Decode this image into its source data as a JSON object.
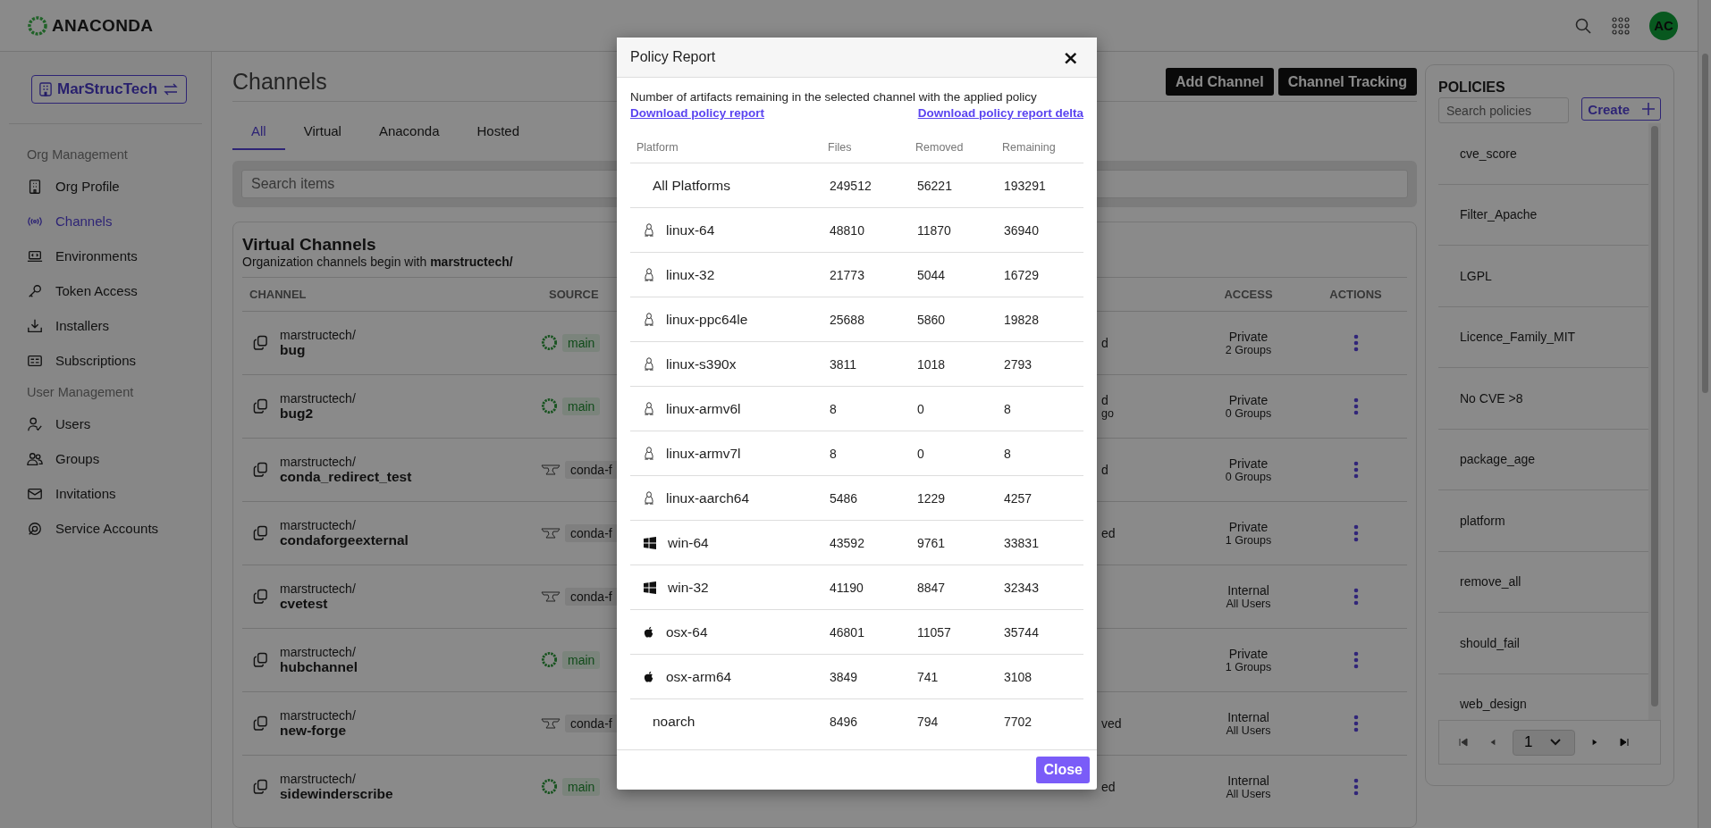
{
  "header": {
    "logo": "ANACONDA",
    "avatar": "AC"
  },
  "sidebar": {
    "org": "MarStrucTech",
    "sections": [
      {
        "title": "Org Management",
        "items": [
          {
            "label": "Org Profile",
            "selected": false
          },
          {
            "label": "Channels",
            "selected": true
          },
          {
            "label": "Environments",
            "selected": false
          },
          {
            "label": "Token Access",
            "selected": false
          },
          {
            "label": "Installers",
            "selected": false
          },
          {
            "label": "Subscriptions",
            "selected": false
          }
        ]
      },
      {
        "title": "User Management",
        "items": [
          {
            "label": "Users",
            "selected": false
          },
          {
            "label": "Groups",
            "selected": false
          },
          {
            "label": "Invitations",
            "selected": false
          },
          {
            "label": "Service Accounts",
            "selected": false
          }
        ]
      }
    ]
  },
  "page": {
    "title": "Channels",
    "buttons": [
      "Add Channel",
      "Channel Tracking"
    ],
    "tabs": [
      {
        "label": "All",
        "selected": true
      },
      {
        "label": "Virtual",
        "selected": false
      },
      {
        "label": "Anaconda",
        "selected": false
      },
      {
        "label": "Hosted",
        "selected": false
      }
    ],
    "search": {
      "placeholder": "Search items"
    }
  },
  "card": {
    "title": "Virtual Channels",
    "subtitle": "Organization channels begin with **marstructech/**",
    "columns": [
      "CHANNEL",
      "SOURCE",
      "ACCESS",
      "ACTIONS"
    ],
    "rows": [
      {
        "prefix": "marstructech/",
        "name": "bug",
        "source": {
          "kind": "anaconda",
          "label": "main"
        },
        "status": [
          "d"
        ],
        "access": "Private",
        "access_detail": "2 Groups"
      },
      {
        "prefix": "marstructech/",
        "name": "bug2",
        "source": {
          "kind": "anaconda",
          "label": "main"
        },
        "status": [
          "d",
          "go"
        ],
        "access": "Private",
        "access_detail": "0 Groups"
      },
      {
        "prefix": "marstructech/",
        "name": "conda_redirect_test",
        "source": {
          "kind": "forge",
          "label": "conda-f"
        },
        "status": [
          "d"
        ],
        "access": "Private",
        "access_detail": "0 Groups"
      },
      {
        "prefix": "marstructech/",
        "name": "condaforgeexternal",
        "source": {
          "kind": "forge",
          "label": "conda-f"
        },
        "status": [
          "ed"
        ],
        "access": "Private",
        "access_detail": "1 Groups"
      },
      {
        "prefix": "marstructech/",
        "name": "cvetest",
        "source": {
          "kind": "forge",
          "label": "conda-f"
        },
        "access": "Internal",
        "access_detail": "All Users"
      },
      {
        "prefix": "marstructech/",
        "name": "hubchannel",
        "source": {
          "kind": "anaconda",
          "label": "main"
        },
        "access": "Private",
        "access_detail": "1 Groups"
      },
      {
        "prefix": "marstructech/",
        "name": "new-forge",
        "source": {
          "kind": "forge",
          "label": "conda-f"
        },
        "status": [
          "ved"
        ],
        "access": "Internal",
        "access_detail": "All Users"
      },
      {
        "prefix": "marstructech/",
        "name": "sidewinderscribe",
        "source": {
          "kind": "anaconda",
          "label": "main"
        },
        "status": [
          "ed"
        ],
        "access": "Internal",
        "access_detail": "All Users"
      }
    ]
  },
  "policies": {
    "title": "POLICIES",
    "search": {
      "placeholder": "Search policies"
    },
    "create": "Create",
    "items": [
      "cve_score",
      "Filter_Apache",
      "LGPL",
      "Licence_Family_MIT",
      "No CVE >8",
      "package_age",
      "platform",
      "remove_all",
      "should_fail",
      "web_design"
    ],
    "page": "1"
  },
  "modal": {
    "title": "Policy Report",
    "close_icon": "×",
    "description": "Number of artifacts remaining in the selected channel with the applied policy",
    "links": [
      "Download policy report",
      "Download policy report delta"
    ],
    "columns": [
      "Platform",
      "Files",
      "Removed",
      "Remaining"
    ],
    "rows": [
      {
        "kind": "plain",
        "platform": "All Platforms",
        "files": "249512",
        "removed": "56221",
        "remaining": "193291"
      },
      {
        "kind": "linux",
        "platform": "linux-64",
        "files": "48810",
        "removed": "11870",
        "remaining": "36940"
      },
      {
        "kind": "linux",
        "platform": "linux-32",
        "files": "21773",
        "removed": "5044",
        "remaining": "16729"
      },
      {
        "kind": "linux",
        "platform": "linux-ppc64le",
        "files": "25688",
        "removed": "5860",
        "remaining": "19828"
      },
      {
        "kind": "linux",
        "platform": "linux-s390x",
        "files": "3811",
        "removed": "1018",
        "remaining": "2793"
      },
      {
        "kind": "linux",
        "platform": "linux-armv6l",
        "files": "8",
        "removed": "0",
        "remaining": "8"
      },
      {
        "kind": "linux",
        "platform": "linux-armv7l",
        "files": "8",
        "removed": "0",
        "remaining": "8"
      },
      {
        "kind": "linux",
        "platform": "linux-aarch64",
        "files": "5486",
        "removed": "1229",
        "remaining": "4257"
      },
      {
        "kind": "windows",
        "platform": "win-64",
        "files": "43592",
        "removed": "9761",
        "remaining": "33831"
      },
      {
        "kind": "windows",
        "platform": "win-32",
        "files": "41190",
        "removed": "8847",
        "remaining": "32343"
      },
      {
        "kind": "apple",
        "platform": "osx-64",
        "files": "46801",
        "removed": "11057",
        "remaining": "35744"
      },
      {
        "kind": "apple",
        "platform": "osx-arm64",
        "files": "3849",
        "removed": "741",
        "remaining": "3108"
      },
      {
        "kind": "plain",
        "platform": "noarch",
        "files": "8496",
        "removed": "794",
        "remaining": "7702"
      }
    ],
    "close_button": "Close"
  }
}
